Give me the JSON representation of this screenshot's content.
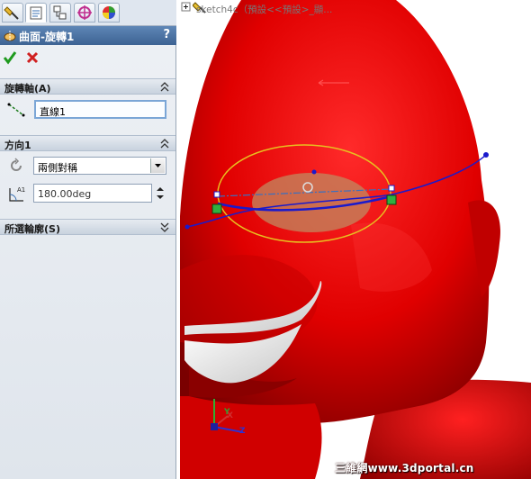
{
  "panel": {
    "title": "曲面-旋轉1",
    "help": "?",
    "tabs": [
      "feature-manager",
      "property-manager",
      "configuration-manager",
      "dimxpert-manager",
      "display-manager"
    ],
    "sections": {
      "axis": {
        "label": "旋轉軸(A)",
        "value": "直線1"
      },
      "direction": {
        "label": "方向1",
        "type_value": "兩側對稱",
        "angle_value": "180.00deg"
      },
      "contours": {
        "label": "所選輪廓(S)"
      }
    }
  },
  "viewport": {
    "tree_label": "sketch4c（預設<<預設>_顯...",
    "triad_labels": {
      "x": "X",
      "y": "Y",
      "z": "Z"
    },
    "watermark": "三維網www.3dportal.cn"
  },
  "colors": {
    "model_red": "#e00000",
    "teeth_white": "#f2f2f2",
    "sketch_blue": "#1a1acc",
    "preview_ellipse": "#e8c020",
    "header_blue": "#4a6fa1"
  }
}
